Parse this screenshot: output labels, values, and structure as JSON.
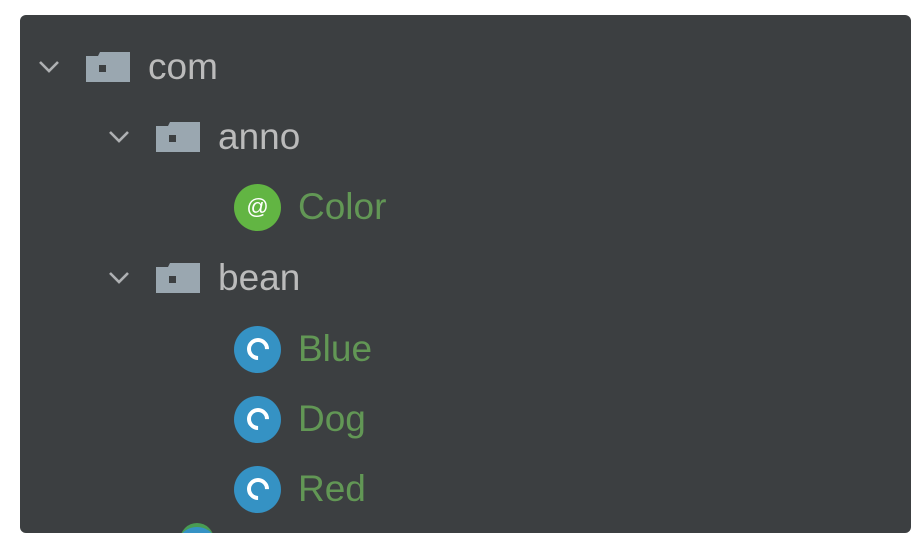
{
  "tree": {
    "com": {
      "label": "com",
      "icon": "folder-icon",
      "expanded": true,
      "children": {
        "anno": {
          "label": "anno",
          "icon": "folder-icon",
          "expanded": true,
          "items": [
            {
              "label": "Color",
              "icon": "annotation-icon",
              "glyph": "@"
            }
          ]
        },
        "bean": {
          "label": "bean",
          "icon": "folder-icon",
          "expanded": true,
          "items": [
            {
              "label": "Blue",
              "icon": "class-icon"
            },
            {
              "label": "Dog",
              "icon": "class-icon"
            },
            {
              "label": "Red",
              "icon": "class-icon"
            }
          ]
        }
      }
    }
  },
  "colors": {
    "panel_bg": "#3c3f41",
    "package_text": "#bbbbbb",
    "class_text": "#629755",
    "annotation_badge": "#62b543",
    "class_badge": "#3592c4",
    "folder": "#9aa7b0"
  }
}
